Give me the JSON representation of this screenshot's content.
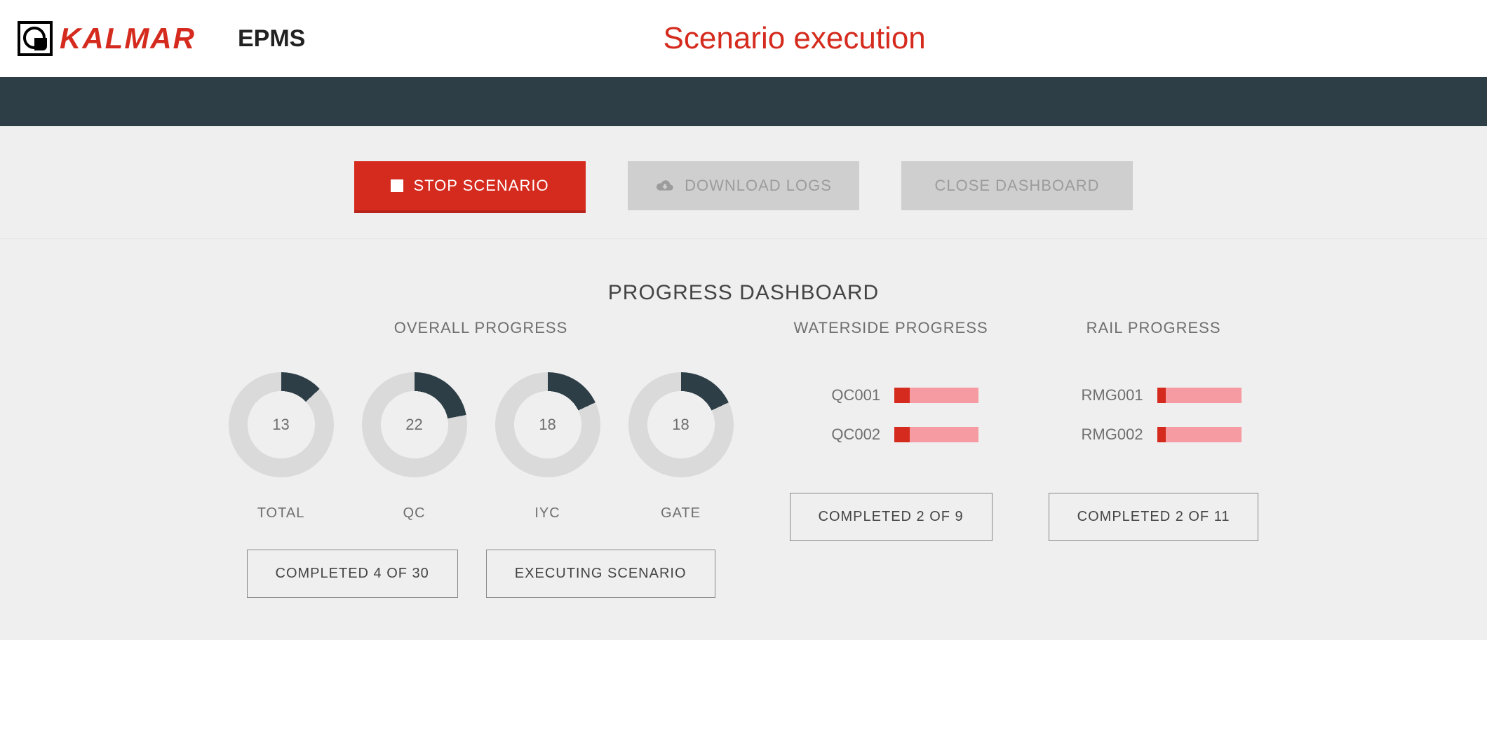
{
  "header": {
    "logo_text": "KALMAR",
    "app_name": "EPMS",
    "page_title": "Scenario execution"
  },
  "toolbar": {
    "stop_label": "STOP SCENARIO",
    "download_label": "DOWNLOAD LOGS",
    "close_label": "CLOSE DASHBOARD"
  },
  "dashboard": {
    "title": "PROGRESS DASHBOARD",
    "overall": {
      "title": "OVERALL PROGRESS",
      "donuts": [
        {
          "label": "TOTAL",
          "percent": 13
        },
        {
          "label": "QC",
          "percent": 22
        },
        {
          "label": "IYC",
          "percent": 18
        },
        {
          "label": "GATE",
          "percent": 18
        }
      ],
      "completed_text": "COMPLETED 4 OF 30",
      "status_text": "EXECUTING SCENARIO"
    },
    "waterside": {
      "title": "WATERSIDE PROGRESS",
      "bars": [
        {
          "label": "QC001",
          "percent": 18
        },
        {
          "label": "QC002",
          "percent": 18
        }
      ],
      "completed_text": "COMPLETED 2 OF 9"
    },
    "rail": {
      "title": "RAIL PROGRESS",
      "bars": [
        {
          "label": "RMG001",
          "percent": 10
        },
        {
          "label": "RMG002",
          "percent": 10
        }
      ],
      "completed_text": "COMPLETED 2 OF 11"
    }
  },
  "chart_data": {
    "donuts": {
      "type": "donut",
      "title": "OVERALL PROGRESS",
      "series": [
        {
          "name": "TOTAL",
          "value": 13,
          "max": 100
        },
        {
          "name": "QC",
          "value": 22,
          "max": 100
        },
        {
          "name": "IYC",
          "value": 18,
          "max": 100
        },
        {
          "name": "GATE",
          "value": 18,
          "max": 100
        }
      ],
      "colors": {
        "fill": "#2D3E47",
        "track": "#DADADA"
      }
    },
    "waterside_bars": {
      "type": "bar",
      "title": "WATERSIDE PROGRESS",
      "categories": [
        "QC001",
        "QC002"
      ],
      "values": [
        18,
        18
      ],
      "ylim": [
        0,
        100
      ],
      "colors": {
        "fill": "#D52B1E",
        "track": "#f59ba1"
      }
    },
    "rail_bars": {
      "type": "bar",
      "title": "RAIL PROGRESS",
      "categories": [
        "RMG001",
        "RMG002"
      ],
      "values": [
        10,
        10
      ],
      "ylim": [
        0,
        100
      ],
      "colors": {
        "fill": "#D52B1E",
        "track": "#f59ba1"
      }
    }
  }
}
